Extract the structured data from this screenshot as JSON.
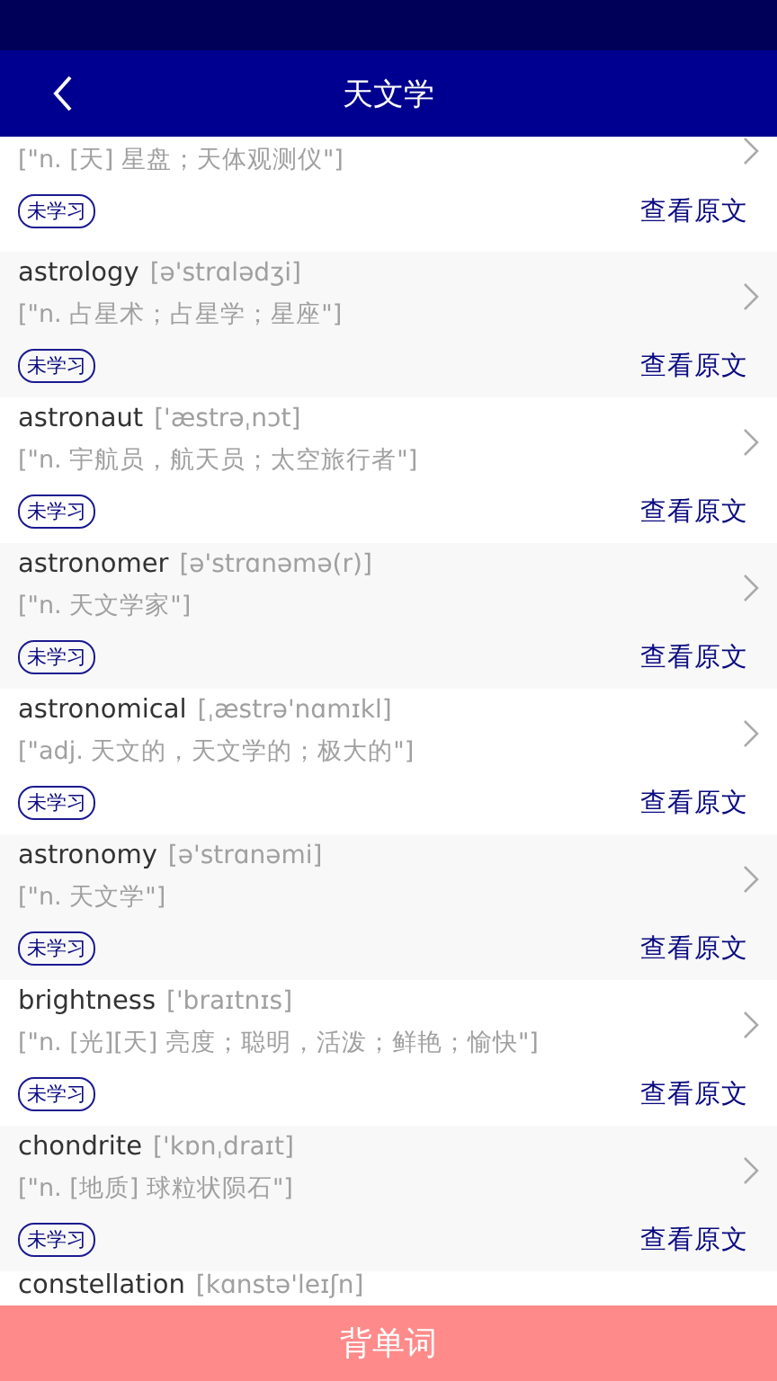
{
  "header": {
    "title": "天文学"
  },
  "words": [
    {
      "definition": "[\"n. [天] 星盘；天体观测仪\"]",
      "status": "未学习",
      "link": "查看原文"
    },
    {
      "word": "astrology",
      "phonetic": "[ə'strɑlədʒi]",
      "definition": "[\"n. 占星术；占星学；星座\"]",
      "status": "未学习",
      "link": "查看原文"
    },
    {
      "word": "astronaut",
      "phonetic": "['æstrəˌnɔt]",
      "definition": "[\"n. 宇航员，航天员；太空旅行者\"]",
      "status": "未学习",
      "link": "查看原文"
    },
    {
      "word": "astronomer",
      "phonetic": "[ə'strɑnəmə(r)]",
      "definition": "[\"n. 天文学家\"]",
      "status": "未学习",
      "link": "查看原文"
    },
    {
      "word": "astronomical",
      "phonetic": "[ˌæstrə'nɑmɪkl]",
      "definition": "[\"adj. 天文的，天文学的；极大的\"]",
      "status": "未学习",
      "link": "查看原文"
    },
    {
      "word": "astronomy",
      "phonetic": "[ə'strɑnəmi]",
      "definition": "[\"n. 天文学\"]",
      "status": "未学习",
      "link": "查看原文"
    },
    {
      "word": "brightness",
      "phonetic": "['braɪtnɪs]",
      "definition": "[\"n. [光][天] 亮度；聪明，活泼；鲜艳；愉快\"]",
      "status": "未学习",
      "link": "查看原文"
    },
    {
      "word": "chondrite",
      "phonetic": "['kɒnˌdraɪt]",
      "definition": "[\"n. [地质] 球粒状陨石\"]",
      "status": "未学习",
      "link": "查看原文"
    },
    {
      "word": "constellation",
      "phonetic": "[kɑnstə'leɪʃn]"
    }
  ],
  "bottom_button": "背单词"
}
